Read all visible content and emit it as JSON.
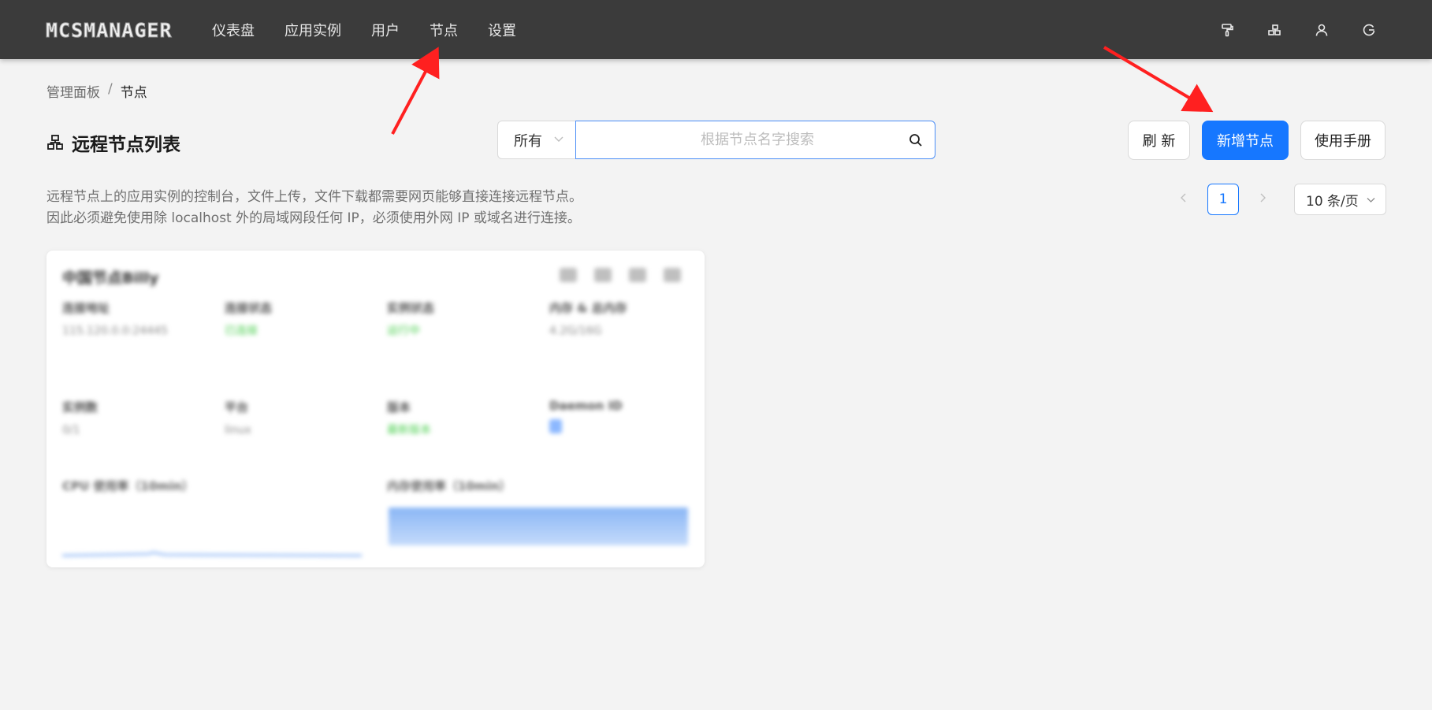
{
  "app": {
    "logo_text": "MCSMANAGER"
  },
  "nav": [
    {
      "label": "仪表盘"
    },
    {
      "label": "应用实例"
    },
    {
      "label": "用户"
    },
    {
      "label": "节点"
    },
    {
      "label": "设置"
    }
  ],
  "top_icons": [
    "paint-roller-icon",
    "cluster-icon",
    "user-icon",
    "logout-icon"
  ],
  "breadcrumb": {
    "parent": "管理面板",
    "separator": "/",
    "current": "节点"
  },
  "page": {
    "title": "远程节点列表",
    "title_icon": "cluster-icon"
  },
  "search": {
    "filter_value": "所有",
    "placeholder": "根据节点名字搜索",
    "value": ""
  },
  "buttons": {
    "refresh": "刷 新",
    "add_node": "新增节点",
    "manual": "使用手册"
  },
  "description": {
    "line1": "远程节点上的应用实例的控制台，文件上传，文件下载都需要网页能够直接连接远程节点。",
    "line2": "因此必须避免使用除 localhost 外的局域网段任何 IP，必须使用外网 IP 或域名进行连接。"
  },
  "pagination": {
    "current_page": "1",
    "page_size": "10 条/页"
  },
  "node_card": {
    "title": "中国节点Billy",
    "fields": [
      {
        "key": "连接地址",
        "value": "115.120.0.0:24445"
      },
      {
        "key": "连接状态",
        "value": "已连接"
      },
      {
        "key": "实例状态",
        "value": "运行中"
      },
      {
        "key": "内存 & 总内存",
        "value": "4.2G/16G"
      },
      {
        "key": "实例数",
        "value": "0/1"
      },
      {
        "key": "平台",
        "value": "linux"
      },
      {
        "key": "版本",
        "value": "最新版本"
      },
      {
        "key": "Daemon ID",
        "value": ""
      }
    ],
    "cpu_label": "CPU 使用率（10min）",
    "mem_label": "内存使用率（10min）"
  },
  "colors": {
    "primary": "#1677ff",
    "topbar": "#3b3b3b",
    "annotation": "#ff2020"
  }
}
